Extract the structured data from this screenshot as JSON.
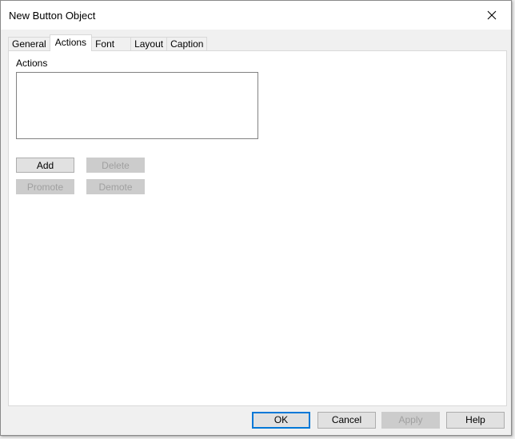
{
  "window": {
    "title": "New Button Object",
    "close_icon": "close-icon"
  },
  "tabs": [
    {
      "label": "General",
      "active": false
    },
    {
      "label": "Actions",
      "active": true
    },
    {
      "label": "Font",
      "active": false
    },
    {
      "label": "Layout",
      "active": false
    },
    {
      "label": "Caption",
      "active": false
    }
  ],
  "actions_panel": {
    "label": "Actions",
    "list_items": [],
    "buttons": {
      "add": {
        "label": "Add",
        "enabled": true
      },
      "delete": {
        "label": "Delete",
        "enabled": false
      },
      "promote": {
        "label": "Promote",
        "enabled": false
      },
      "demote": {
        "label": "Demote",
        "enabled": false
      }
    }
  },
  "footer": {
    "ok": {
      "label": "OK",
      "enabled": true,
      "default": true
    },
    "cancel": {
      "label": "Cancel",
      "enabled": true
    },
    "apply": {
      "label": "Apply",
      "enabled": false
    },
    "help": {
      "label": "Help",
      "enabled": true
    }
  },
  "colors": {
    "default_button_border": "#0078d7",
    "disabled_text": "#a0a0a0"
  }
}
